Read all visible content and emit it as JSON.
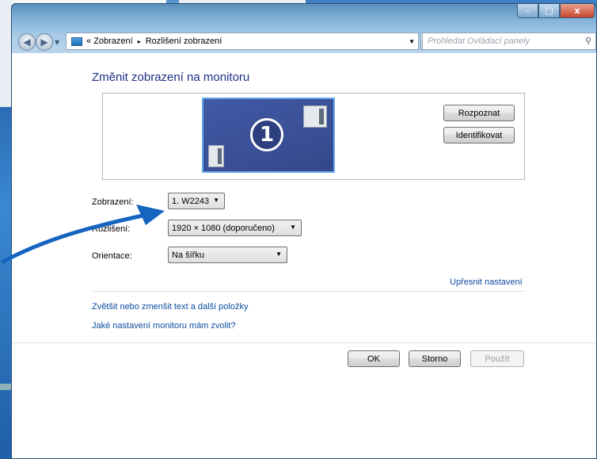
{
  "window": {
    "caption_buttons": {
      "minimize": "–",
      "maximize": "□",
      "close": "x"
    }
  },
  "navigation": {
    "back_icon": "◀",
    "forward_icon": "▶",
    "breadcrumb": {
      "prefix": "«",
      "items": [
        "Zobrazení",
        "Rozlišení zobrazení"
      ],
      "separator": "▸"
    },
    "refresh_icon": "↻",
    "search_placeholder": "Prohledat Ovládací panely",
    "search_icon": "⚲"
  },
  "main": {
    "heading": "Změnit zobrazení na monitoru",
    "monitor_number": "1",
    "detect_button": "Rozpoznat",
    "identify_button": "Identifikovat",
    "display_label": "Zobrazení:",
    "display_value": "1. W2243",
    "resolution_label": "Rozlišení:",
    "resolution_value": "1920 × 1080 (doporučeno)",
    "orientation_label": "Orientace:",
    "orientation_value": "Na šířku",
    "advanced_link": "Upřesnit nastavení",
    "text_size_link": "Zvětšit nebo zmenšit text a další položky",
    "which_settings_link": "Jaké nastavení monitoru mám zvolit?",
    "ok_button": "OK",
    "cancel_button": "Storno",
    "apply_button": "Použít"
  },
  "colors": {
    "heading": "#1e3287",
    "link": "#0d4da0",
    "annotation_arrow": "#1565c0"
  }
}
